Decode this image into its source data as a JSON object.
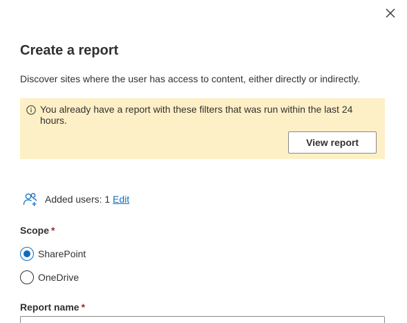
{
  "panel": {
    "title": "Create a report",
    "description": "Discover sites where the user has access to content, either directly or indirectly.",
    "close_icon": "close-icon"
  },
  "warning": {
    "icon": "info-icon",
    "message": "You already have a report with these filters that was run within the last 24 hours.",
    "button_label": "View report",
    "background_color": "#fdf0c6"
  },
  "users": {
    "icon": "people-add-icon",
    "label": "Added users: 1",
    "edit_label": "Edit"
  },
  "scope": {
    "label": "Scope",
    "required_mark": "*",
    "options": [
      {
        "label": "SharePoint",
        "checked": true
      },
      {
        "label": "OneDrive",
        "checked": false
      }
    ]
  },
  "report_name": {
    "label": "Report name",
    "required_mark": "*",
    "value": ""
  },
  "colors": {
    "accent": "#0f6cbd",
    "required": "#a4262c",
    "text": "#323130"
  }
}
